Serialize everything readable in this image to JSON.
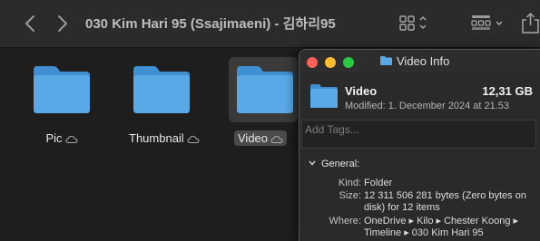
{
  "window": {
    "title": "030 Kim Hari 95 (Ssajimaeni) - 김하리95"
  },
  "toolbar": {
    "back_icon": "chevron-left-icon",
    "forward_icon": "chevron-right-icon",
    "view_icon": "icon-grid-view-icon",
    "group_icon": "group-by-icon",
    "share_icon": "share-icon"
  },
  "folders": [
    {
      "label": "Pic",
      "cloud": true,
      "selected": false
    },
    {
      "label": "Thumbnail",
      "cloud": true,
      "selected": false
    },
    {
      "label": "Video",
      "cloud": true,
      "selected": true
    }
  ],
  "info": {
    "title": "Video Info",
    "name": "Video",
    "size": "12,31 GB",
    "modified": "Modified: 1. December 2024 at 21.53",
    "tags_placeholder": "Add Tags...",
    "section": "General:",
    "kind_key": "Kind:",
    "kind_val": "Folder",
    "size_key": "Size:",
    "size_val": "12 311 506 281 bytes (Zero bytes on disk) for 12 items",
    "where_key": "Where:",
    "where_val": "OneDrive ▸ Kilo ▸ Chester Koong ▸ Timeline ▸ 030 Kim Hari 95"
  },
  "colors": {
    "folder_blue": "#5aa9e6",
    "folder_blue_dark": "#3f8fd2",
    "close": "#fe5f57",
    "minimize": "#febc2e",
    "zoom": "#28c840"
  }
}
